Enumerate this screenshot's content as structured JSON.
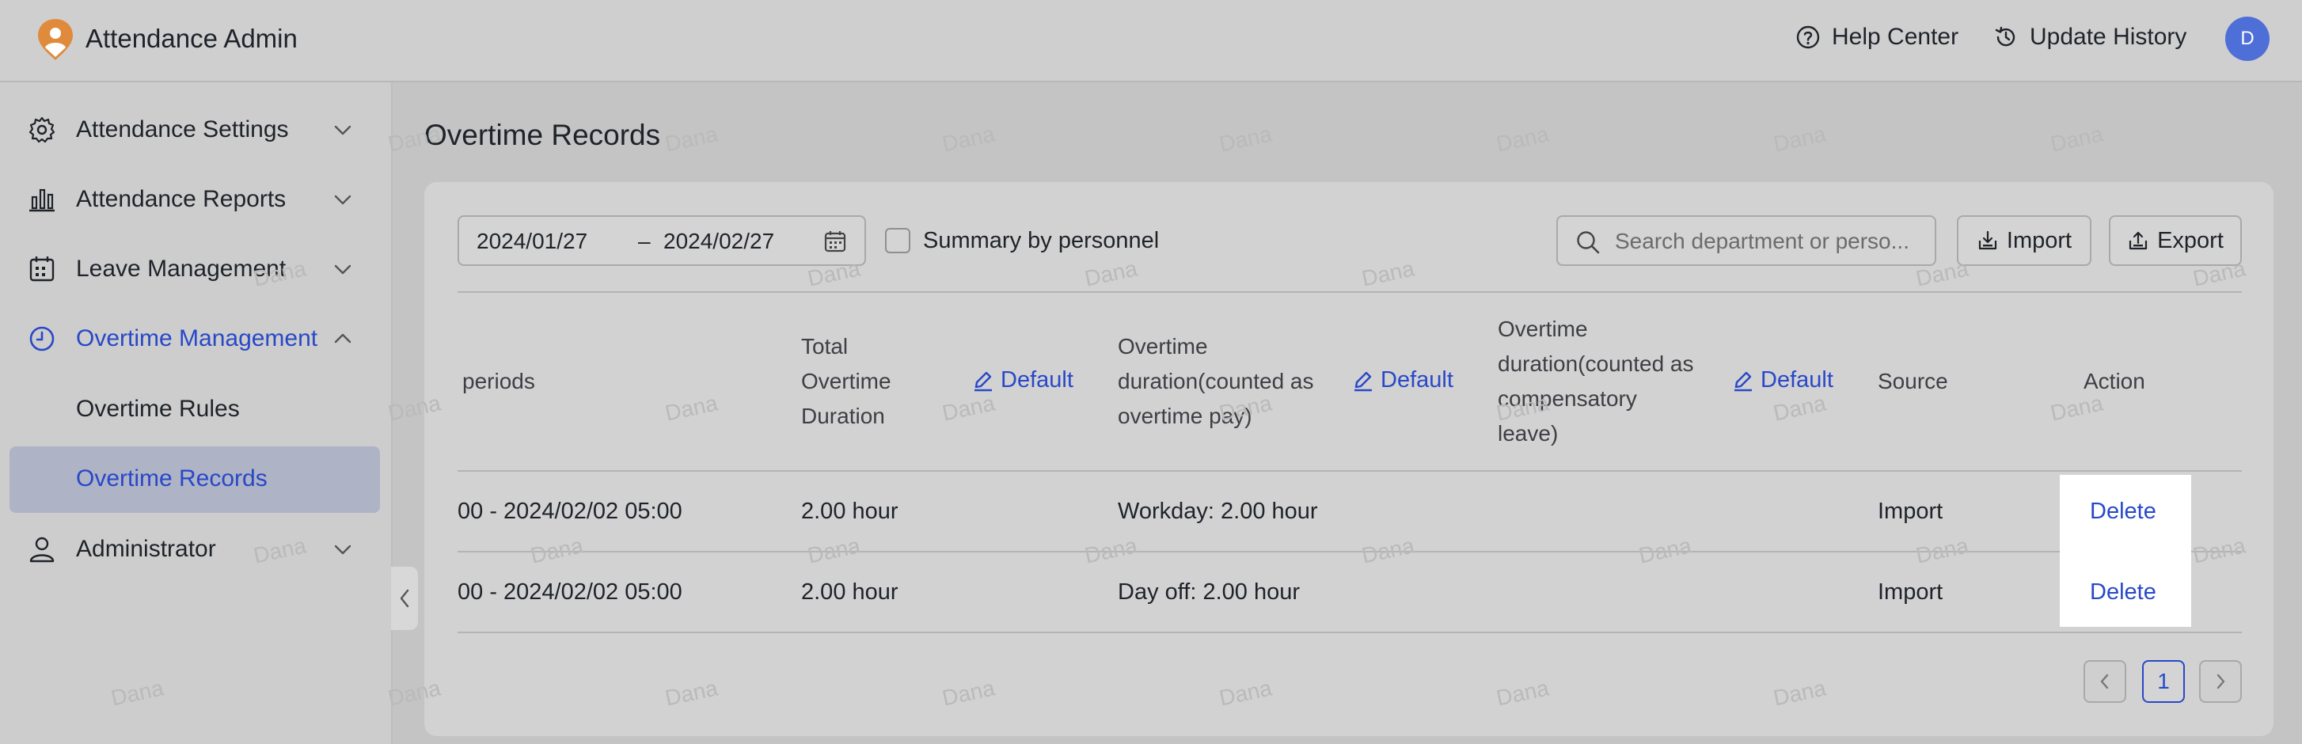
{
  "app": {
    "title": "Attendance Admin"
  },
  "header": {
    "help_center": "Help Center",
    "update_history": "Update History",
    "avatar_initial": "D"
  },
  "sidebar": {
    "items": [
      {
        "label": "Attendance Settings",
        "icon": "gear-icon"
      },
      {
        "label": "Attendance Reports",
        "icon": "bar-chart-icon"
      },
      {
        "label": "Leave Management",
        "icon": "calendar-icon"
      },
      {
        "label": "Overtime Management",
        "icon": "clock-icon",
        "active": true
      },
      {
        "label": "Administrator",
        "icon": "user-icon"
      }
    ],
    "sub_items": [
      {
        "label": "Overtime Rules"
      },
      {
        "label": "Overtime Records",
        "selected": true
      }
    ]
  },
  "page": {
    "title": "Overtime Records"
  },
  "filters": {
    "date_start": "2024/01/27",
    "date_sep": "–",
    "date_end": "2024/02/27",
    "summary_label": "Summary by personnel",
    "search_placeholder": "Search department or perso...",
    "import_label": "Import",
    "export_label": "Export"
  },
  "table": {
    "headers": {
      "periods": "periods",
      "total_l1": "Total",
      "total_l2": "Overtime",
      "total_l3": "Duration",
      "pay_l1": "Overtime",
      "pay_l2": "duration(counted as",
      "pay_l3": "overtime pay)",
      "comp_l1": "Overtime",
      "comp_l2": "duration(counted as",
      "comp_l3": "compensatory",
      "comp_l4": "leave)",
      "default_label": "Default",
      "source": "Source",
      "action": "Action"
    },
    "rows": [
      {
        "period": "00 - 2024/02/02 05:00",
        "total": "2.00 hour",
        "pay": "Workday: 2.00 hour",
        "comp": "",
        "source": "Import",
        "action": "Delete"
      },
      {
        "period": "00 - 2024/02/02 05:00",
        "total": "2.00 hour",
        "pay": "Day off: 2.00 hour",
        "comp": "",
        "source": "Import",
        "action": "Delete"
      }
    ]
  },
  "pagination": {
    "current": "1"
  },
  "watermark": "Dana",
  "colors": {
    "accent": "#2848c8",
    "logo": "#e08a3c",
    "avatar": "#4f6fd8"
  }
}
